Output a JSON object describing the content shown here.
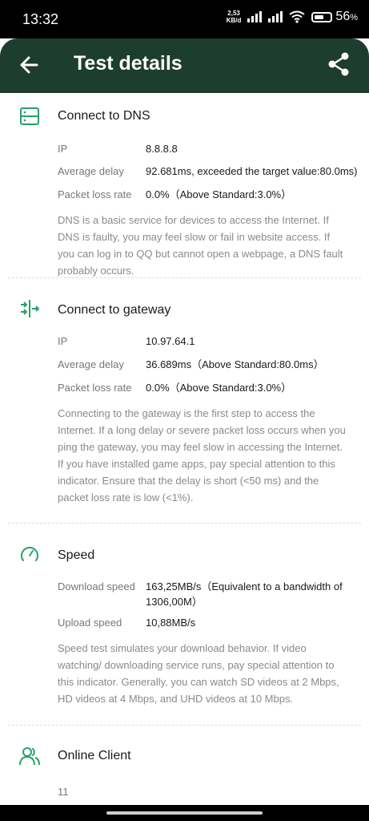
{
  "status_bar": {
    "time": "13:32",
    "net_speed_value": "2,53",
    "net_speed_unit": "KB/d",
    "battery_pct": "56",
    "battery_pct_sign": "%"
  },
  "header": {
    "title": "Test details",
    "back_icon": "arrow-left-icon",
    "share_icon": "share-icon"
  },
  "sections": [
    {
      "title": "Connect to DNS",
      "icon": "server-icon",
      "rows": [
        {
          "label": "IP",
          "value": "8.8.8.8"
        },
        {
          "label": "Average delay",
          "value": "92.681ms, exceeded the target value:80.0ms)"
        },
        {
          "label": "Packet loss rate",
          "value": "0.0%（Above Standard:3.0%）"
        }
      ],
      "description": "DNS is a basic service for devices to access the Internet. If DNS is faulty, you may feel slow or fail in website access. If you can log in to QQ but cannot open a webpage, a DNS fault probably occurs."
    },
    {
      "title": "Connect to gateway",
      "icon": "gateway-icon",
      "rows": [
        {
          "label": "IP",
          "value": "10.97.64.1"
        },
        {
          "label": "Average delay",
          "value": "36.689ms（Above Standard:80.0ms）"
        },
        {
          "label": "Packet loss rate",
          "value": "0.0%（Above Standard:3.0%）"
        }
      ],
      "description": "Connecting to the gateway is the first step to access the Internet. If a long delay or severe packet loss occurs when you ping the gateway, you may feel slow in accessing the Internet. If you have installed game apps, pay special attention to this indicator. Ensure that the delay is short (<50 ms) and the packet loss rate is low (<1%)."
    },
    {
      "title": "Speed",
      "icon": "speedometer-icon",
      "rows": [
        {
          "label": "Download speed",
          "value": "163,25MB/s（Equivalent to a bandwidth of 1306,00M）"
        },
        {
          "label": "Upload speed",
          "value": "10,88MB/s"
        }
      ],
      "description": "Speed test simulates your download behavior. If video watching/ downloading service runs, pay special attention to this indicator. Generally, you can watch SD videos at 2 Mbps, HD videos at 4 Mbps, and UHD videos at 10 Mbps."
    },
    {
      "title": "Online Client",
      "icon": "users-icon",
      "value": "11"
    }
  ],
  "colors": {
    "header_bg": "#1d3d2f",
    "accent": "#2aa06a"
  }
}
